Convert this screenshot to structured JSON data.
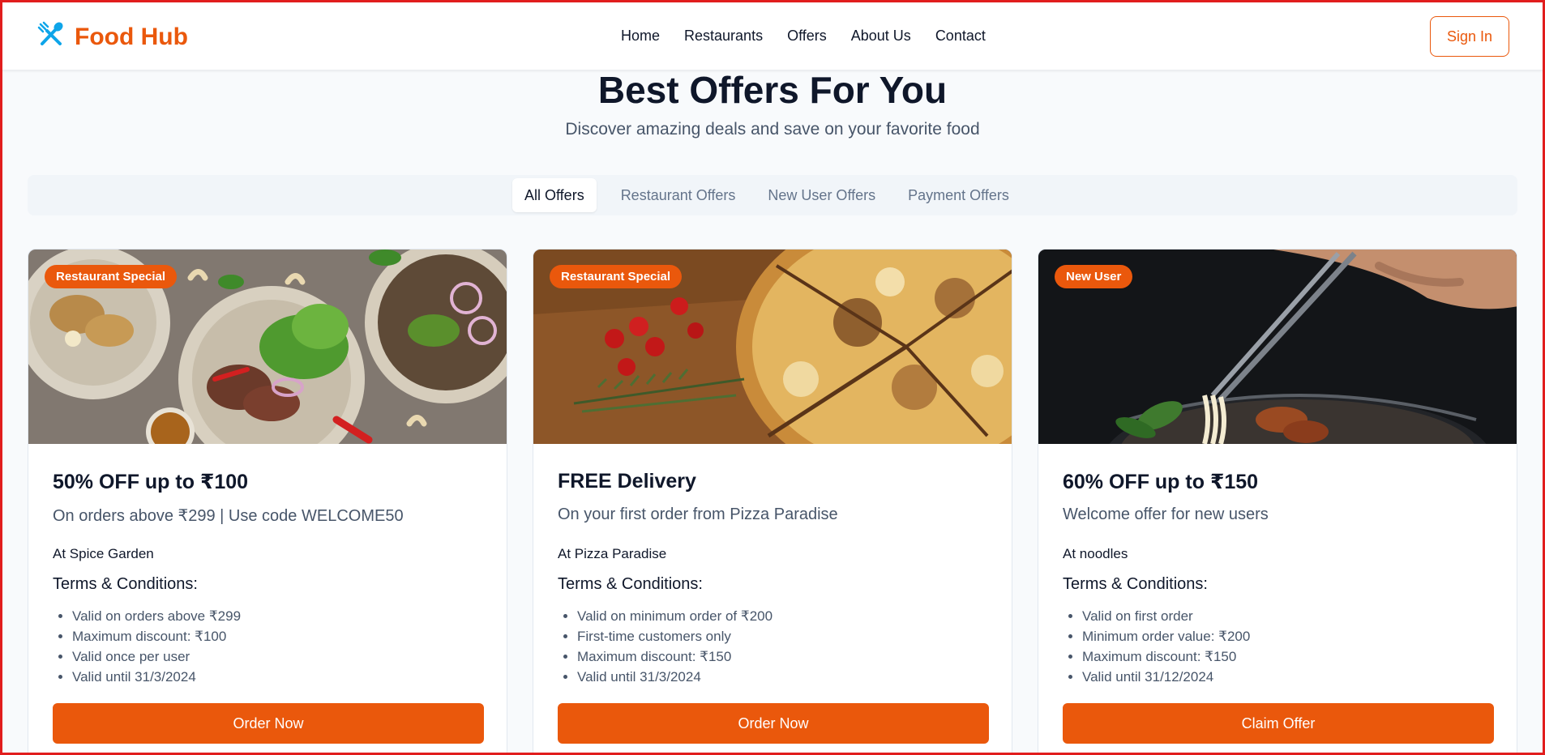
{
  "brand": {
    "name": "Food Hub",
    "icon": "fork-spoon-icon",
    "accent": "#ea580c"
  },
  "nav": [
    {
      "label": "Home"
    },
    {
      "label": "Restaurants"
    },
    {
      "label": "Offers"
    },
    {
      "label": "About Us"
    },
    {
      "label": "Contact"
    }
  ],
  "header": {
    "signin_label": "Sign In"
  },
  "hero": {
    "title": "Best Offers For You",
    "subtitle": "Discover amazing deals and save on your favorite food"
  },
  "tabs": [
    {
      "label": "All Offers",
      "active": true
    },
    {
      "label": "Restaurant Offers"
    },
    {
      "label": "New User Offers"
    },
    {
      "label": "Payment Offers"
    }
  ],
  "offers": [
    {
      "badge": "Restaurant Special",
      "title": "50% OFF up to ₹100",
      "description": "On orders above ₹299 | Use code WELCOME50",
      "restaurant": "At Spice Garden",
      "terms_heading": "Terms & Conditions:",
      "terms": [
        "Valid on orders above ₹299",
        "Maximum discount: ₹100",
        "Valid once per user",
        "Valid until 31/3/2024"
      ],
      "button": "Order Now"
    },
    {
      "badge": "Restaurant Special",
      "title": "FREE Delivery",
      "description": "On your first order from Pizza Paradise",
      "restaurant": "At Pizza Paradise",
      "terms_heading": "Terms & Conditions:",
      "terms": [
        "Valid on minimum order of ₹200",
        "First-time customers only",
        "Maximum discount: ₹150",
        "Valid until 31/3/2024"
      ],
      "button": "Order Now"
    },
    {
      "badge": "New User",
      "title": "60% OFF up to ₹150",
      "description": "Welcome offer for new users",
      "restaurant": "At noodles",
      "terms_heading": "Terms & Conditions:",
      "terms": [
        "Valid on first order",
        "Minimum order value: ₹200",
        "Maximum discount: ₹150",
        "Valid until 31/12/2024"
      ],
      "button": "Claim Offer"
    }
  ]
}
